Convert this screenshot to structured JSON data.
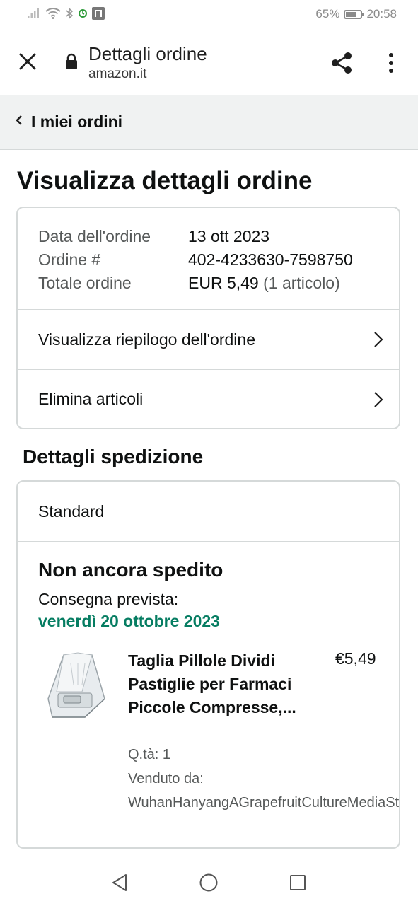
{
  "status_bar": {
    "battery": "65%",
    "battery_level": 0.65,
    "time": "20:58"
  },
  "browser": {
    "title": "Dettagli ordine",
    "domain": "amazon.it"
  },
  "breadcrumb": {
    "label": "I miei ordini"
  },
  "page": {
    "title": "Visualizza dettagli ordine"
  },
  "order_info": {
    "date_label": "Data dell'ordine",
    "date_value": "13 ott 2023",
    "number_label": "Ordine #",
    "number_value": "402-4233630-7598750",
    "total_label": "Totale ordine",
    "total_value": "EUR 5,49",
    "total_items": "(1 articolo)"
  },
  "links": {
    "summary": "Visualizza riepilogo dell'ordine",
    "delete": "Elimina articoli"
  },
  "shipping": {
    "section_title": "Dettagli spedizione",
    "type": "Standard",
    "status": "Non ancora spedito",
    "delivery_label": "Consegna prevista:",
    "delivery_date": "venerdì 20 ottobre 2023"
  },
  "product": {
    "name": "Taglia Pillole Dividi Pastiglie per Farmaci Piccole Compresse,...",
    "price": "€5,49",
    "quantity": "Q.tà: 1",
    "seller_label": "Venduto da:",
    "seller_name": "WuhanHanyangAGrapefruitCultureMediaSt"
  },
  "colors": {
    "delivery_green": "#067d62",
    "border": "#d5d9d9",
    "breadcrumb_bg": "#f0f2f2"
  }
}
